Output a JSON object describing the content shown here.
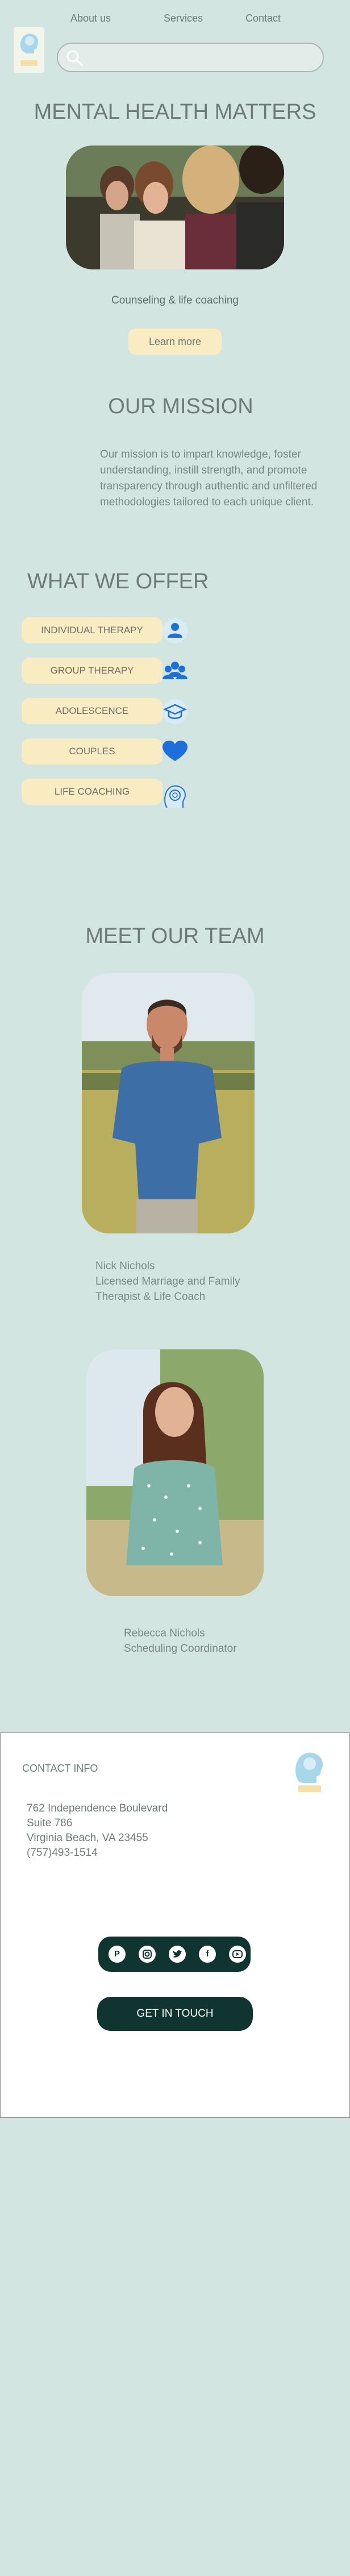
{
  "nav": {
    "about": "About us",
    "services": "Services",
    "contact": "Contact"
  },
  "search": {
    "placeholder": "",
    "value": ""
  },
  "hero": {
    "title": "MENTAL HEALTH MATTERS",
    "subtitle": "Counseling & life coaching",
    "button": "Learn more"
  },
  "mission": {
    "title": "OUR MISSION",
    "text": "Our mission is to impart knowledge, foster understanding, instill strength, and promote transparency through authentic and unfiltered methodologies tailored to each unique client."
  },
  "offer": {
    "title": "WHAT WE OFFER",
    "items": [
      {
        "label": "INDIVIDUAL THERAPY",
        "icon": "person-icon"
      },
      {
        "label": "GROUP THERAPY",
        "icon": "group-icon"
      },
      {
        "label": "ADOLESCENCE",
        "icon": "graduation-cap-icon"
      },
      {
        "label": "COUPLES",
        "icon": "heart-icon"
      },
      {
        "label": "LIFE COACHING",
        "icon": "brain-icon"
      }
    ]
  },
  "team": {
    "title": "MEET OUR TEAM",
    "members": [
      {
        "name": "Nick Nichols",
        "role_line1": "Licensed Marriage and Family",
        "role_line2": "Therapist & Life Coach"
      },
      {
        "name": "Rebecca Nichols",
        "role_line1": "Scheduling Coordinator"
      }
    ]
  },
  "contact": {
    "title": "CONTACT INFO",
    "address1": "762 Independence Boulevard",
    "address2": "Suite 786",
    "address3": "Virginia Beach, VA 23455",
    "phone": "(757)493-1514",
    "social_icons": [
      "pinterest-icon",
      "instagram-icon",
      "twitter-icon",
      "facebook-icon",
      "youtube-icon"
    ],
    "cta": "GET IN TOUCH"
  },
  "colors": {
    "background": "#d2e5e0",
    "pill": "#faecc2",
    "dark": "#103530",
    "icon_blue": "#1e6fd9"
  }
}
